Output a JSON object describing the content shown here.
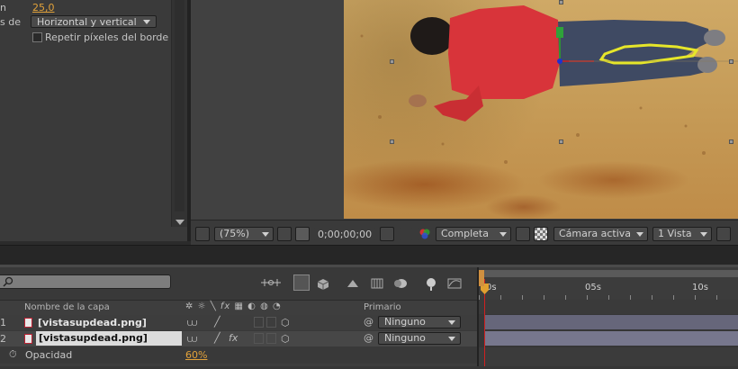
{
  "effect_controls": {
    "value_label": "n",
    "value": "25,0",
    "edge_label": "s de",
    "edge_option": "Horizontal y vertical",
    "repeat_edge_pixels": "Repetir píxeles del borde"
  },
  "viewer_toolbar": {
    "magnification": "(75%)",
    "timecode": "0;00;00;00",
    "resolution": "Completa",
    "camera": "Cámara activa",
    "views": "1 Vista"
  },
  "timeline": {
    "columns": {
      "layer_name": "Nombre de la capa",
      "parent": "Primario"
    },
    "layers": [
      {
        "index": "1",
        "name": "[vistasupdead.png]",
        "parent": "Ninguno"
      },
      {
        "index": "2",
        "name": "[vistasupdead.png]",
        "parent": "Ninguno"
      }
    ],
    "property": {
      "name": "Opacidad",
      "value": "60%"
    },
    "ruler_labels": [
      "0s",
      "05s",
      "10s"
    ]
  },
  "colors": {
    "accent_orange": "#e2a23a",
    "playhead": "#d02020",
    "track": "#66667a"
  },
  "icons": [
    "pickwhip-icon",
    "stopwatch-icon",
    "png-file-icon",
    "3d-cube-icon",
    "snapshot-camera-icon",
    "grid-icon",
    "channel-rgb-icon"
  ]
}
